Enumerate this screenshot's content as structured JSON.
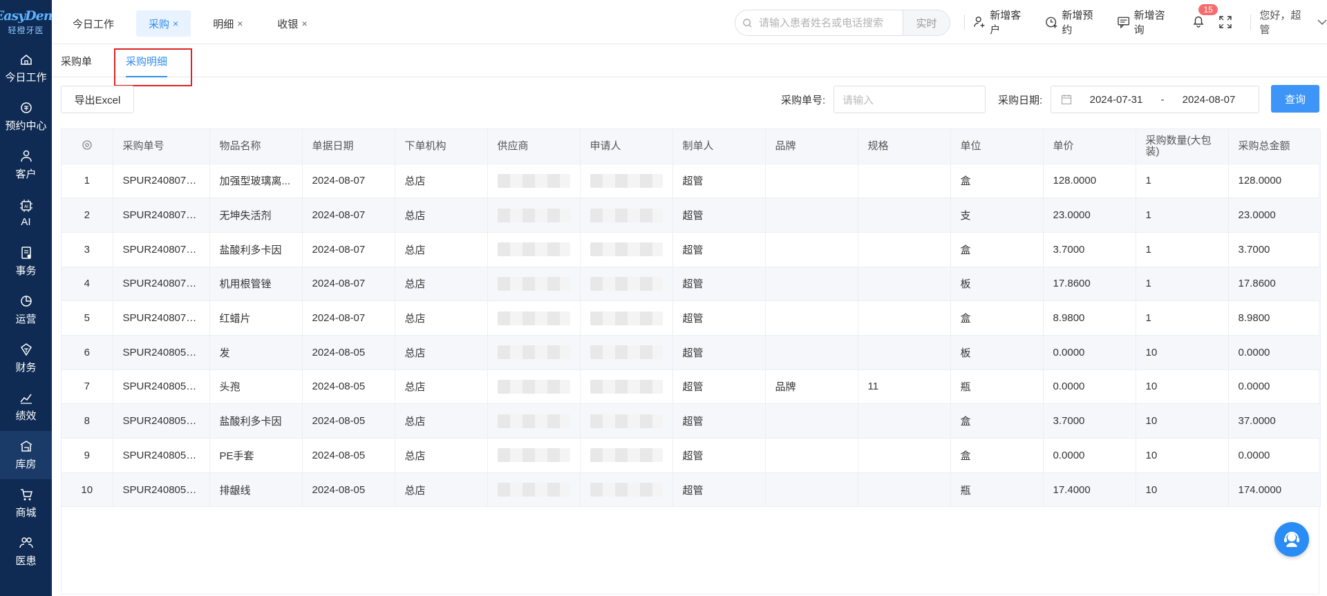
{
  "brand": {
    "name": "EasyDent",
    "subtitle": "轻橙牙医"
  },
  "sidebar": {
    "items": [
      {
        "label": "今日工作",
        "icon": "home-icon"
      },
      {
        "label": "预约中心",
        "icon": "appointment-icon"
      },
      {
        "label": "客户",
        "icon": "user-icon"
      },
      {
        "label": "AI",
        "icon": "ai-chip-icon"
      },
      {
        "label": "事务",
        "icon": "task-icon"
      },
      {
        "label": "运营",
        "icon": "pie-chart-icon"
      },
      {
        "label": "财务",
        "icon": "finance-icon"
      },
      {
        "label": "绩效",
        "icon": "trend-icon"
      },
      {
        "label": "库房",
        "icon": "warehouse-icon",
        "active": true
      },
      {
        "label": "商城",
        "icon": "cart-icon"
      },
      {
        "label": "医患",
        "icon": "doctor-patient-icon"
      }
    ]
  },
  "topbar": {
    "tabs": [
      {
        "label": "今日工作",
        "closable": false
      },
      {
        "label": "采购",
        "closable": true,
        "active": true
      },
      {
        "label": "明细",
        "closable": true
      },
      {
        "label": "收银",
        "closable": true
      }
    ],
    "close_glyph": "×",
    "search_placeholder": "请输入患者姓名或电话搜索",
    "search_mode": "实时",
    "actions": {
      "new_customer": "新增客户",
      "new_appointment": "新增预约",
      "new_consult": "新增咨询"
    },
    "notification_count": "15",
    "greeting": "您好，超管"
  },
  "subtabs": {
    "purchase_order": "采购单",
    "purchase_detail": "采购明细"
  },
  "filter": {
    "export_label": "导出Excel",
    "order_no_label": "采购单号:",
    "order_no_placeholder": "请输入",
    "date_label": "采购日期:",
    "date_start": "2024-07-31",
    "date_sep": "-",
    "date_end": "2024-08-07",
    "query_label": "查询"
  },
  "table": {
    "columns": [
      "采购单号",
      "物品名称",
      "单据日期",
      "下单机构",
      "供应商",
      "申请人",
      "制单人",
      "品牌",
      "规格",
      "单位",
      "单价",
      "采购数量(大包装)",
      "采购总金额"
    ],
    "rows": [
      {
        "idx": "1",
        "order_no": "SPUR2408070...",
        "item": "加强型玻璃离...",
        "date": "2024-08-07",
        "org": "总店",
        "maker": "超管",
        "brand": "",
        "spec": "",
        "unit": "盒",
        "price": "128.0000",
        "qty": "1",
        "total": "128.0000"
      },
      {
        "idx": "2",
        "order_no": "SPUR2408070...",
        "item": "无坤失活剂",
        "date": "2024-08-07",
        "org": "总店",
        "maker": "超管",
        "brand": "",
        "spec": "",
        "unit": "支",
        "price": "23.0000",
        "qty": "1",
        "total": "23.0000"
      },
      {
        "idx": "3",
        "order_no": "SPUR2408070...",
        "item": "盐酸利多卡因",
        "date": "2024-08-07",
        "org": "总店",
        "maker": "超管",
        "brand": "",
        "spec": "",
        "unit": "盒",
        "price": "3.7000",
        "qty": "1",
        "total": "3.7000"
      },
      {
        "idx": "4",
        "order_no": "SPUR2408070...",
        "item": "机用根管锉",
        "date": "2024-08-07",
        "org": "总店",
        "maker": "超管",
        "brand": "",
        "spec": "",
        "unit": "板",
        "price": "17.8600",
        "qty": "1",
        "total": "17.8600"
      },
      {
        "idx": "5",
        "order_no": "SPUR2408070...",
        "item": "红蜡片",
        "date": "2024-08-07",
        "org": "总店",
        "maker": "超管",
        "brand": "",
        "spec": "",
        "unit": "盒",
        "price": "8.9800",
        "qty": "1",
        "total": "8.9800"
      },
      {
        "idx": "6",
        "order_no": "SPUR2408050...",
        "item": "发",
        "date": "2024-08-05",
        "org": "总店",
        "maker": "超管",
        "brand": "",
        "spec": "",
        "unit": "板",
        "price": "0.0000",
        "qty": "10",
        "total": "0.0000"
      },
      {
        "idx": "7",
        "order_no": "SPUR2408050...",
        "item": "头孢",
        "date": "2024-08-05",
        "org": "总店",
        "maker": "超管",
        "brand": "品牌",
        "spec": "11",
        "unit": "瓶",
        "price": "0.0000",
        "qty": "10",
        "total": "0.0000"
      },
      {
        "idx": "8",
        "order_no": "SPUR2408050...",
        "item": "盐酸利多卡因",
        "date": "2024-08-05",
        "org": "总店",
        "maker": "超管",
        "brand": "",
        "spec": "",
        "unit": "盒",
        "price": "3.7000",
        "qty": "10",
        "total": "37.0000"
      },
      {
        "idx": "9",
        "order_no": "SPUR2408050...",
        "item": "PE手套",
        "date": "2024-08-05",
        "org": "总店",
        "maker": "超管",
        "brand": "",
        "spec": "",
        "unit": "盒",
        "price": "0.0000",
        "qty": "10",
        "total": "0.0000"
      },
      {
        "idx": "10",
        "order_no": "SPUR2408050...",
        "item": "排龈线",
        "date": "2024-08-05",
        "org": "总店",
        "maker": "超管",
        "brand": "",
        "spec": "",
        "unit": "瓶",
        "price": "17.4000",
        "qty": "10",
        "total": "174.0000"
      }
    ]
  }
}
